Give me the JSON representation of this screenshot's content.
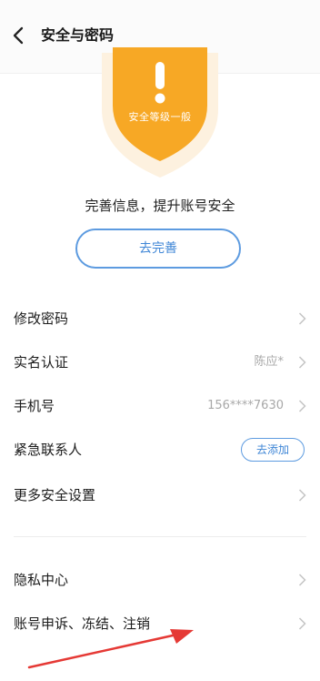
{
  "header": {
    "title": "安全与密码",
    "back_icon": "back-arrow-icon"
  },
  "security": {
    "level_text": "安全等级一般",
    "badge_color": "#f7a825",
    "icon": "exclamation-shield-icon",
    "tip": "完善信息，提升账号安全",
    "complete_button": "去完善"
  },
  "settings": {
    "change_password": "修改密码",
    "real_name": {
      "label": "实名认证",
      "value": "陈应*"
    },
    "phone": {
      "label": "手机号",
      "value": "156****7630"
    },
    "emergency_contact": {
      "label": "紧急联系人",
      "button": "去添加"
    },
    "more_security": "更多安全设置"
  },
  "other": {
    "privacy_center": "隐私中心",
    "appeal_freeze_cancel": "账号申诉、冻结、注销"
  },
  "colors": {
    "accent": "#3f86d6",
    "annotation_arrow": "#e53935"
  }
}
